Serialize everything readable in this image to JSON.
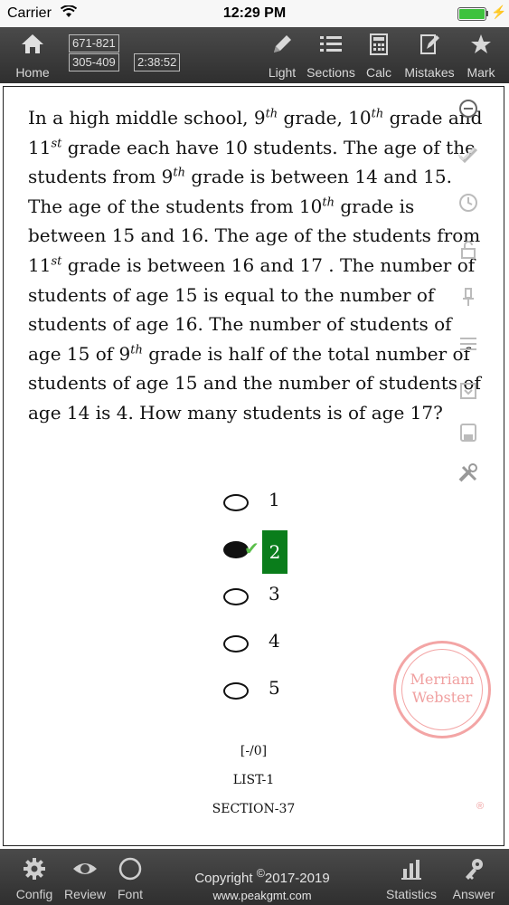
{
  "status_bar": {
    "carrier": "Carrier",
    "time": "12:29 PM",
    "battery_color": "#3ec23e"
  },
  "toolbar": {
    "home": "Home",
    "score_top": "671-821",
    "score_bottom": "305-409",
    "timer": "2:38:52",
    "light": "Light",
    "sections": "Sections",
    "calc": "Calc",
    "mistakes": "Mistakes",
    "mark": "Mark"
  },
  "question": {
    "parts": [
      {
        "t": "In a high middle school, 9"
      },
      {
        "sup": "th"
      },
      {
        "t": " grade, 10"
      },
      {
        "sup": "th"
      },
      {
        "t": " grade and 11"
      },
      {
        "sup": "st"
      },
      {
        "t": " grade each have 10 students. The age of the students from 9"
      },
      {
        "sup": "th"
      },
      {
        "t": " grade is between 14 and 15. The age of the students from 10"
      },
      {
        "sup": "th"
      },
      {
        "t": " grade is between 15 and 16. The age of the students from 11"
      },
      {
        "sup": "st"
      },
      {
        "t": " grade is between 16 and 17 . The number of students of age 15 is equal to the number of students of age 16. The number of students of age 15 of 9"
      },
      {
        "sup": "th"
      },
      {
        "t": " grade is half of the total number of students of age 15 and the number of students of age 14 is 4. How many students is of age 17?"
      }
    ]
  },
  "options": [
    {
      "label": "1",
      "selected": false,
      "correct": false
    },
    {
      "label": "2",
      "selected": true,
      "correct": true
    },
    {
      "label": "3",
      "selected": false,
      "correct": false
    },
    {
      "label": "4",
      "selected": false,
      "correct": false
    },
    {
      "label": "5",
      "selected": false,
      "correct": false
    }
  ],
  "meta": {
    "score": "[-/0]",
    "list": "LIST-1",
    "section": "SECTION-37"
  },
  "stamp": {
    "line1": "Merriam",
    "line2": "Webster",
    "mark": "®"
  },
  "bottom_bar": {
    "config": "Config",
    "review": "Review",
    "font": "Font",
    "copyright": "Copyright",
    "copyright_symbol": "©",
    "years": "2017-2019",
    "url": "www.peakgmt.com",
    "statistics": "Statistics",
    "answer": "Answer"
  },
  "colors": {
    "toolbar_bg": "#3a3a3a",
    "correct_bg": "#0a7d1b",
    "check": "#5bbf4b",
    "stamp": "#f0a0a0"
  },
  "side_icons": [
    "minus-circle-icon",
    "check-icon",
    "clock-icon",
    "lock-icon",
    "pin-icon",
    "list-icon",
    "download-icon",
    "save-icon",
    "tools-icon"
  ]
}
